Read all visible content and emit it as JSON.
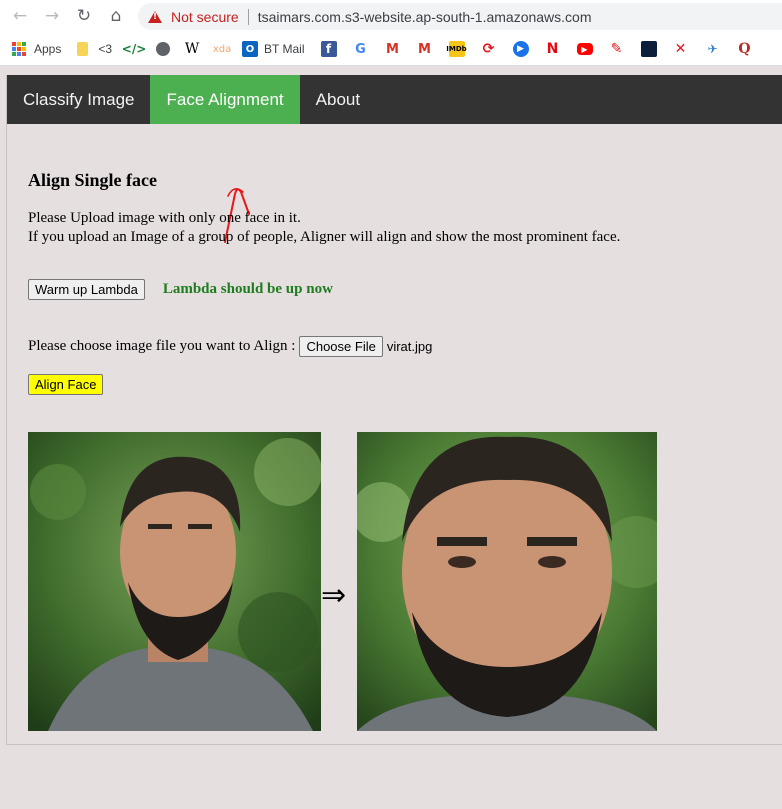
{
  "browser": {
    "nav": {
      "back_icon": "back-arrow-icon",
      "forward_icon": "forward-arrow-icon",
      "reload_icon": "reload-icon",
      "home_icon": "home-icon"
    },
    "security_label": "Not secure",
    "url": "tsaimars.com.s3-website.ap-south-1.amazonaws.com",
    "bookmarks": [
      {
        "label": "Apps",
        "icon": "apps-grid-icon"
      },
      {
        "label": "",
        "icon": "yellow-note-icon"
      },
      {
        "label": "<3",
        "icon": ""
      },
      {
        "label": "",
        "icon": "code-icon"
      },
      {
        "label": "",
        "icon": "globe-icon"
      },
      {
        "label": "",
        "icon": "wikipedia-icon"
      },
      {
        "label": "",
        "icon": "xda-icon"
      },
      {
        "label": "BT Mail",
        "icon": "outlook-icon"
      },
      {
        "label": "",
        "icon": "facebook-icon"
      },
      {
        "label": "",
        "icon": "google-icon"
      },
      {
        "label": "",
        "icon": "gmail-icon"
      },
      {
        "label": "",
        "icon": "gmail-icon"
      },
      {
        "label": "",
        "icon": "imdb-icon"
      },
      {
        "label": "",
        "icon": "red-swirl-icon"
      },
      {
        "label": "",
        "icon": "play-circle-icon"
      },
      {
        "label": "",
        "icon": "netflix-icon"
      },
      {
        "label": "",
        "icon": "youtube-icon"
      },
      {
        "label": "",
        "icon": "feather-icon"
      },
      {
        "label": "",
        "icon": "dark-square-icon"
      },
      {
        "label": "",
        "icon": "red-x-icon"
      },
      {
        "label": "",
        "icon": "bird-icon"
      },
      {
        "label": "",
        "icon": "quora-icon"
      }
    ]
  },
  "nav": {
    "tabs": [
      {
        "label": "Classify Image",
        "active": false
      },
      {
        "label": "Face Alignment",
        "active": true
      },
      {
        "label": "About",
        "active": false
      }
    ]
  },
  "main": {
    "heading": "Align Single face",
    "desc_line1": "Please Upload image with only one face in it.",
    "desc_line2": "If you upload an Image of a group of people, Aligner will align and show the most prominent face.",
    "warmup_label": "Warm up Lambda",
    "lambda_status": "Lambda should be up now",
    "choose_prompt": "Please choose image file you want to Align :",
    "choose_file_label": "Choose File",
    "file_name": "virat.jpg",
    "align_label": "Align Face",
    "arrow": "⇒"
  },
  "colors": {
    "nav_bg": "#333333",
    "active_tab": "#4caf50",
    "page_bg": "#e6dfe0",
    "status_green": "#1e7d1e",
    "align_btn": "#ffff00",
    "annotation": "#e8171b"
  }
}
